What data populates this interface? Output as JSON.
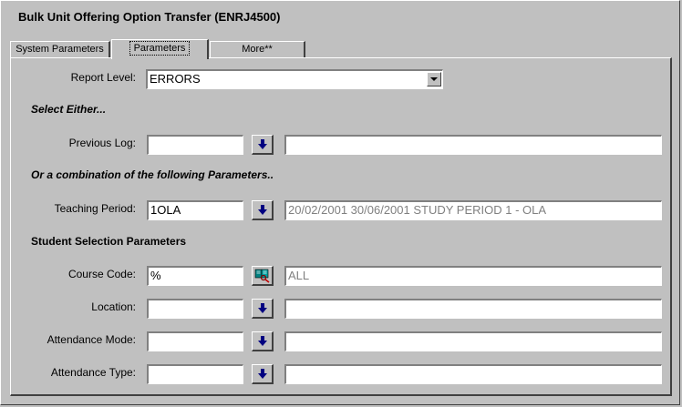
{
  "window": {
    "title": "Bulk Unit Offering Option Transfer (ENRJ4500)"
  },
  "tabs": [
    {
      "label": "System Parameters"
    },
    {
      "label": "Parameters"
    },
    {
      "label": "More**"
    }
  ],
  "form": {
    "report_level": {
      "label": "Report Level:",
      "value": "ERRORS"
    },
    "select_either": "Select Either...",
    "previous_log": {
      "label": "Previous Log:",
      "value": "",
      "description": ""
    },
    "combination_note": "Or a combination of the following Parameters..",
    "teaching_period": {
      "label": "Teaching  Period:",
      "value": "1OLA",
      "description": "20/02/2001 30/06/2001 STUDY PERIOD 1 - OLA"
    },
    "student_section_heading": "Student Selection Parameters",
    "course_code": {
      "label": "Course Code:",
      "value": "%",
      "description": "ALL"
    },
    "location": {
      "label": "Location:",
      "value": "",
      "description": ""
    },
    "attendance_mode": {
      "label": "Attendance Mode:",
      "value": "",
      "description": ""
    },
    "attendance_type": {
      "label": "Attendance Type:",
      "value": "",
      "description": ""
    }
  },
  "icons": {
    "lov_arrow": "down-arrow-icon",
    "course_lookup": "book-search-icon",
    "dropdown": "chevron-down-icon"
  },
  "colors": {
    "background": "#c0c0c0",
    "arrow_blue": "#000080",
    "disabled_text": "#808080"
  }
}
